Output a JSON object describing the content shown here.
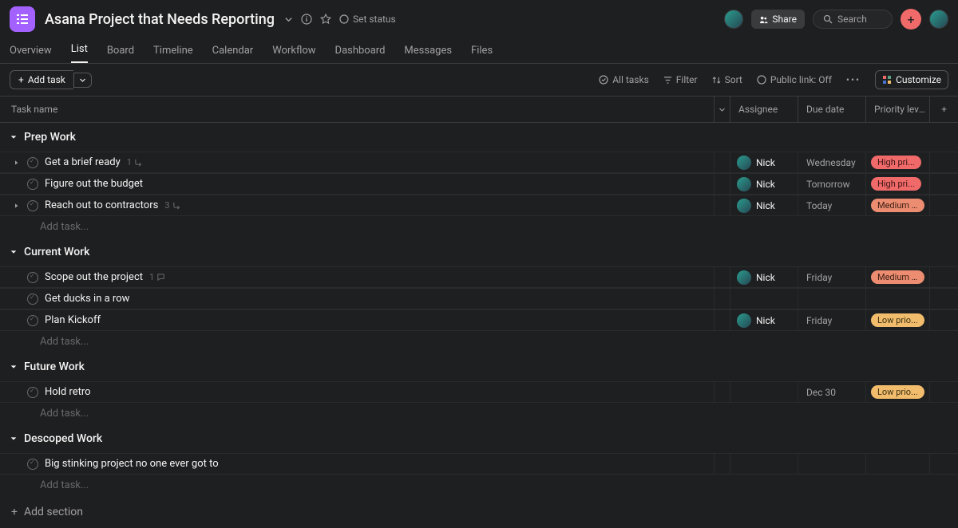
{
  "header": {
    "title": "Asana Project that Needs Reporting",
    "set_status": "Set status",
    "share": "Share",
    "search_placeholder": "Search"
  },
  "tabs": [
    "Overview",
    "List",
    "Board",
    "Timeline",
    "Calendar",
    "Workflow",
    "Dashboard",
    "Messages",
    "Files"
  ],
  "active_tab": "List",
  "toolbar": {
    "add_task": "Add task",
    "all_tasks": "All tasks",
    "filter": "Filter",
    "sort": "Sort",
    "public_link": "Public link: Off",
    "customize": "Customize"
  },
  "columns": {
    "name": "Task name",
    "assignee": "Assignee",
    "due": "Due date",
    "priority": "Priority level?"
  },
  "add_task_row": "Add task...",
  "add_section": "Add section",
  "sections": [
    {
      "name": "Prep Work",
      "tasks": [
        {
          "caret": true,
          "name": "Get a brief ready",
          "sub_count": "1",
          "sub_icon": true,
          "assignee": "Nick",
          "due": "Wednesday",
          "priority": "High pri...",
          "plevel": "high"
        },
        {
          "caret": false,
          "name": "Figure out the budget",
          "assignee": "Nick",
          "due": "Tomorrow",
          "priority": "High pri...",
          "plevel": "high"
        },
        {
          "caret": true,
          "name": "Reach out to contractors",
          "sub_count": "3",
          "sub_icon": true,
          "assignee": "Nick",
          "due": "Today",
          "priority": "Medium ...",
          "plevel": "medium"
        }
      ]
    },
    {
      "name": "Current Work",
      "tasks": [
        {
          "caret": false,
          "name": "Scope out the project",
          "comment_count": "1",
          "comment_icon": true,
          "assignee": "Nick",
          "due": "Friday",
          "priority": "Medium ...",
          "plevel": "medium"
        },
        {
          "caret": false,
          "name": "Get ducks in a row"
        },
        {
          "caret": false,
          "name": "Plan Kickoff",
          "assignee": "Nick",
          "due": "Friday",
          "priority": "Low prio...",
          "plevel": "low"
        }
      ]
    },
    {
      "name": "Future Work",
      "tasks": [
        {
          "caret": false,
          "name": "Hold retro",
          "due": "Dec 30",
          "priority": "Low prio...",
          "plevel": "low"
        }
      ]
    },
    {
      "name": "Descoped Work",
      "tasks": [
        {
          "caret": false,
          "name": "Big stinking project no one ever got to"
        }
      ]
    }
  ]
}
